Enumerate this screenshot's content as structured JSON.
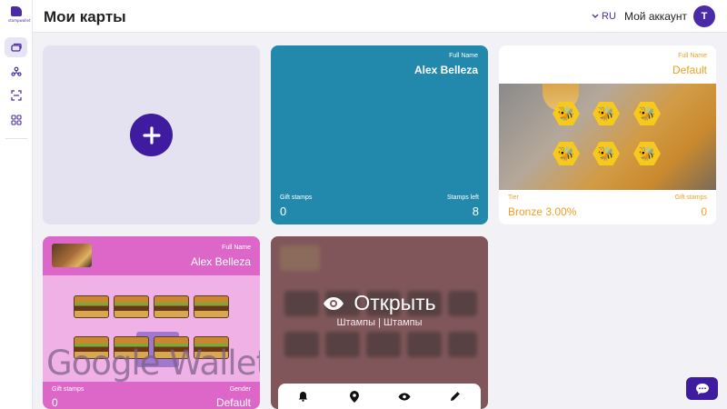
{
  "app": {
    "logo_text": "stampwallet"
  },
  "header": {
    "title": "Мои карты",
    "lang": "RU",
    "account": "Мой аккаунт",
    "avatar_initial": "Т"
  },
  "sidebar": {
    "items": [
      {
        "icon": "cards-icon",
        "active": true
      },
      {
        "icon": "users-icon",
        "active": false
      },
      {
        "icon": "scan-icon",
        "active": false
      },
      {
        "icon": "grid-icon",
        "active": false
      }
    ]
  },
  "cards": {
    "teal": {
      "header_label": "Full Name",
      "header_value": "Alex Belleza",
      "left_label": "Gift stamps",
      "left_value": "0",
      "right_label": "Stamps left",
      "right_value": "8",
      "color": "#2289ac"
    },
    "honey": {
      "header_label": "Full Name",
      "header_value": "Default",
      "left_label": "Tier",
      "left_value": "Bronze 3.00%",
      "right_label": "Gift stamps",
      "right_value": "0",
      "accent": "#f0a020"
    },
    "pink": {
      "header_label": "Full Name",
      "header_value": "Alex Belleza",
      "watermark": "Google Wallet",
      "left_label": "Gift stamps",
      "left_value": "0",
      "right_label": "Gender",
      "right_value": "Default",
      "color": "#dc67c8"
    },
    "hover": {
      "open_label": "Открыть",
      "type_label": "Штампы | Штампы"
    }
  },
  "colors": {
    "primary": "#3f1c9f",
    "background": "#f2f2f6"
  }
}
